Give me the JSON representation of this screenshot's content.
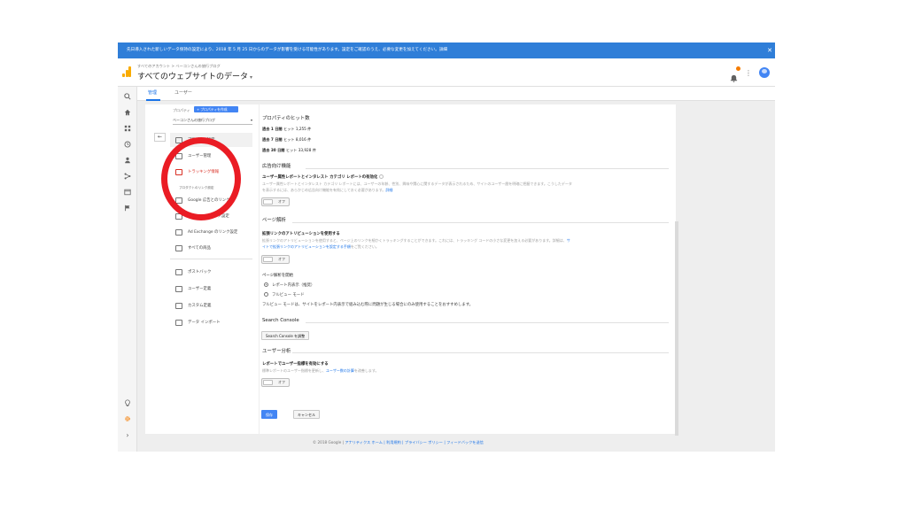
{
  "banner": {
    "text": "先日導入された新しいデータ保持の設定により、2018 年 5 月 25 日からのデータが影響を受ける可能性があります。設定をご確認のうえ、必要な変更を加えてください。詳細",
    "close_icon": "close-icon"
  },
  "header": {
    "breadcrumb": "すべてのアカウント > ベーコンさんの旅行ブログ",
    "view_title": "すべてのウェブサイトのデータ",
    "caret": "▾",
    "kebab": "⋮",
    "accent_color": "#f9ab00"
  },
  "tabs": [
    {
      "label": "管理"
    },
    {
      "label": "ユーザー"
    }
  ],
  "property": {
    "label": "プロパティ",
    "create_button": "+ プロパティを作成",
    "selected": "ベーコンさんの旅行ブログ",
    "back": "←",
    "menu": [
      {
        "label": "プロパティ設定",
        "icon": "settings-page-icon"
      },
      {
        "label": "ユーザー管理",
        "icon": "users-icon"
      },
      {
        "label": "トラッキング情報",
        "icon": "code-icon"
      },
      {
        "label": "プロダクトのリンク設定",
        "icon": "link-icon"
      },
      {
        "label": "Google 広告とのリンク",
        "icon": "ads-icon"
      },
      {
        "label": "AdSense のリンク設定",
        "icon": "adsense-icon"
      },
      {
        "label": "Ad Exchange のリンク設定",
        "icon": "adexchange-icon"
      },
      {
        "label": "すべての商品",
        "icon": "products-icon"
      },
      {
        "label": "ポストバック",
        "icon": "postback-icon"
      },
      {
        "label": "ユーザー定義",
        "icon": "user-definition-icon"
      },
      {
        "label": "カスタム定義",
        "icon": "dd-icon"
      },
      {
        "label": "データ インポート",
        "icon": "dd-icon"
      }
    ]
  },
  "main": {
    "hits_title": "プロパティのヒット数",
    "hits": [
      {
        "label": "過去 1 日間",
        "value": "ヒット 1,255 件"
      },
      {
        "label": "過去 7 日間",
        "value": "ヒット 8,016 件"
      },
      {
        "label": "過去 30 日間",
        "value": "ヒット 33,928 件"
      }
    ],
    "ads_title": "広告向け機能",
    "ads_heading": "ユーザー属性レポートとインタレスト カテゴリ レポートの有効化",
    "ads_desc_1": "ユーザー属性レポートとインタレスト カテゴリ レポートには、ユーザーの年齢、性別、興味や関心に関するデータが表示されるため、サイトのユーザー層を明確に把握できます。こうしたデータ",
    "ads_desc_2": "を表示するには、あらかじめ広告向け機能を有効にしておく必要があります。",
    "ads_desc_link": "詳細",
    "off_label": "オフ",
    "page_title": "ページ解析",
    "enhanced_heading": "拡張リンクのアトリビューションを使用する",
    "enhanced_desc_1": "拡張リンクのアトリビューションを使用すると、ページ上のリンクを細かくトラッキングすることができます。これには、トラッキング コードの小さな変更を加える必要があります。詳細は、",
    "enhanced_link_a": "サ",
    "enhanced_link_b": "イトで拡張リンクのアトリビューションを設定する手順",
    "enhanced_desc_2": "をご覧ください。",
    "page_default_heading": "ページ解析を開始",
    "radio_1": "レポート内表示（推奨）",
    "radio_2": "フルビュー モード",
    "fullview_desc": "フルビュー モードは、サイトをレポート内表示で組み込む際に問題が生じる場合にのみ使用することをおすすめします。",
    "search_console_title": "Search Console",
    "search_console_button": "Search Console を調整",
    "user_analysis_title": "ユーザー分析",
    "user_metric_heading": "レポートでユーザー指標を有効にする",
    "user_metric_desc": "標準レポートのユーザー指標を更新し、",
    "user_metric_link": "ユーザー数の計算",
    "user_metric_desc_2": "を改善します。",
    "save": "保存",
    "cancel": "キャンセル"
  },
  "footer": {
    "copyright": "© 2018 Google |",
    "links": "アナリティクス ホーム | 利用規約 | プライバシー ポリシー | フィードバックを送信"
  }
}
